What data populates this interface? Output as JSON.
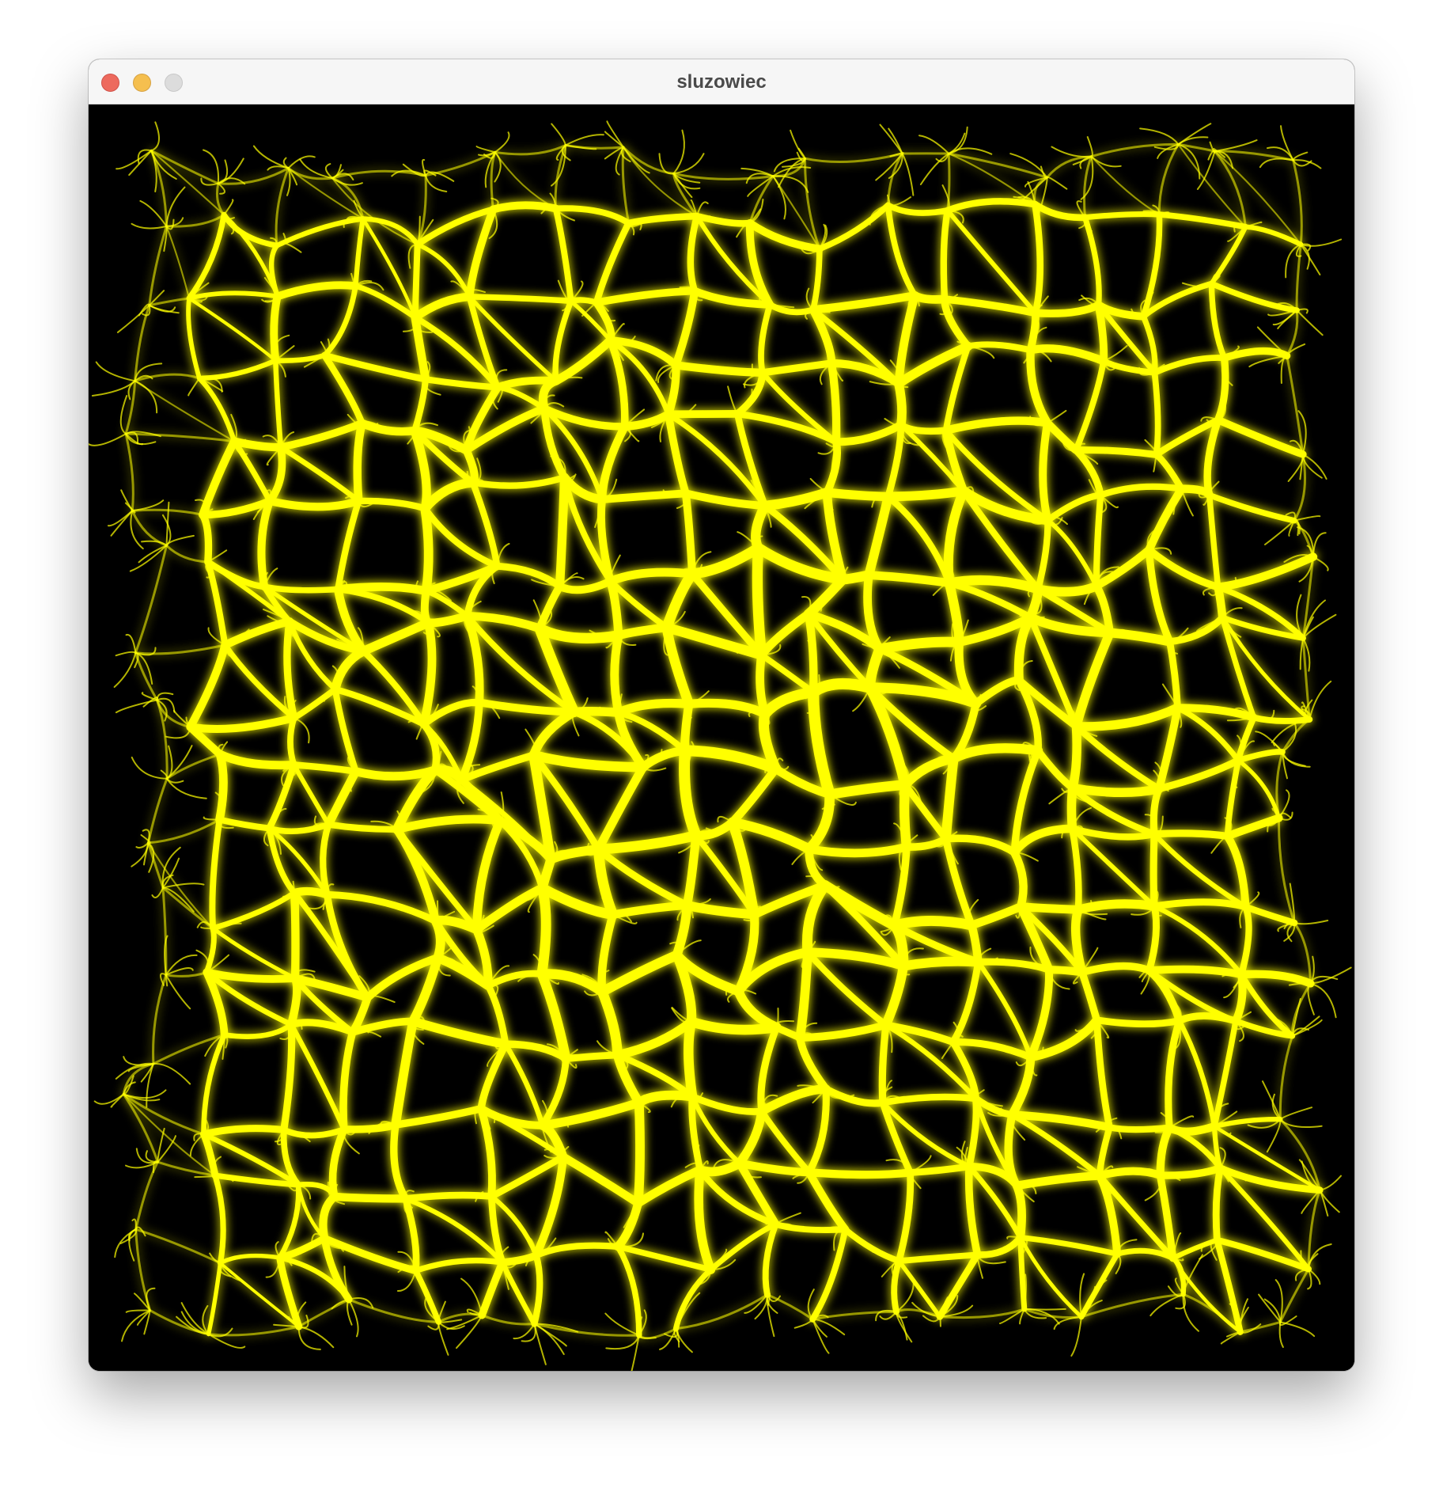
{
  "window": {
    "title": "sluzowiec"
  },
  "simulation": {
    "background_color": "#000000",
    "trail_color": "#ffff00",
    "glow_color": "#ffff00",
    "description_icon": "slime-mold-network"
  }
}
